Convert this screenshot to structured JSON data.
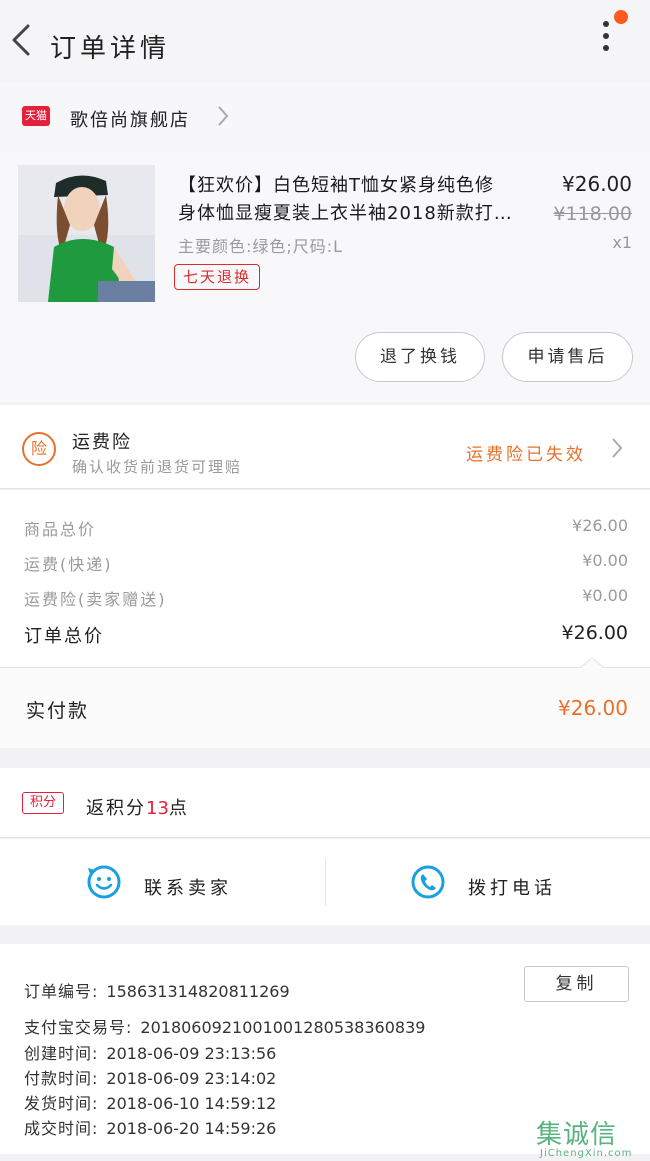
{
  "header": {
    "title": "订单详情"
  },
  "shop": {
    "badge": "天猫",
    "name": "歌倍尚旗舰店"
  },
  "product": {
    "title_line1": "【狂欢价】白色短袖T恤女紧身纯色修",
    "title_line2": "身体恤显瘦夏装上衣半袖2018新款打…",
    "spec": "主要颜色:绿色;尺码:L",
    "return_badge": "七天退换",
    "price": "¥26.00",
    "original_price": "¥118.00",
    "quantity": "x1",
    "actions": {
      "refund": "退了换钱",
      "after_sale": "申请售后"
    }
  },
  "insurance": {
    "icon_text": "险",
    "title": "运费险",
    "description": "确认收货前退货可理赔",
    "status": "运费险已失效"
  },
  "costs": [
    {
      "label": "商品总价",
      "value": "¥26.00"
    },
    {
      "label": "运费(快递)",
      "value": "¥0.00"
    },
    {
      "label": "运费险(卖家赠送)",
      "value": "¥0.00"
    }
  ],
  "order_total": {
    "label": "订单总价",
    "value": "¥26.00"
  },
  "paid": {
    "label": "实付款",
    "value": "¥26.00"
  },
  "points": {
    "badge": "积分",
    "prefix": "返积分",
    "amount": "13",
    "suffix": "点"
  },
  "contact": {
    "seller": "联系卖家",
    "phone": "拨打电话"
  },
  "order_info": {
    "copy_button": "复制",
    "rows": [
      {
        "key": "订单编号:",
        "value": "1586313148208112​69"
      },
      {
        "key": "支付宝交易号:",
        "value": "2018060921001001280538360839"
      },
      {
        "key": "创建时间:",
        "value": "2018-06-09 23:13:56"
      },
      {
        "key": "付款时间:",
        "value": "2018-06-09 23:14:02"
      },
      {
        "key": "发货时间:",
        "value": "2018-06-10 14:59:12"
      },
      {
        "key": "成交时间:",
        "value": "2018-06-20 14:59:26"
      }
    ]
  },
  "watermark": {
    "logo": "集诚信",
    "url": "JiChengXin.com"
  },
  "colors": {
    "accent_orange": "#e8702a",
    "tmall_red": "#e4203c",
    "contact_blue": "#1aa0e0"
  },
  "icons": {
    "back": "back-chevron-icon",
    "more": "more-vertical-icon",
    "chevron": "chevron-right-icon",
    "smile": "smile-chat-icon",
    "phone": "phone-icon"
  }
}
